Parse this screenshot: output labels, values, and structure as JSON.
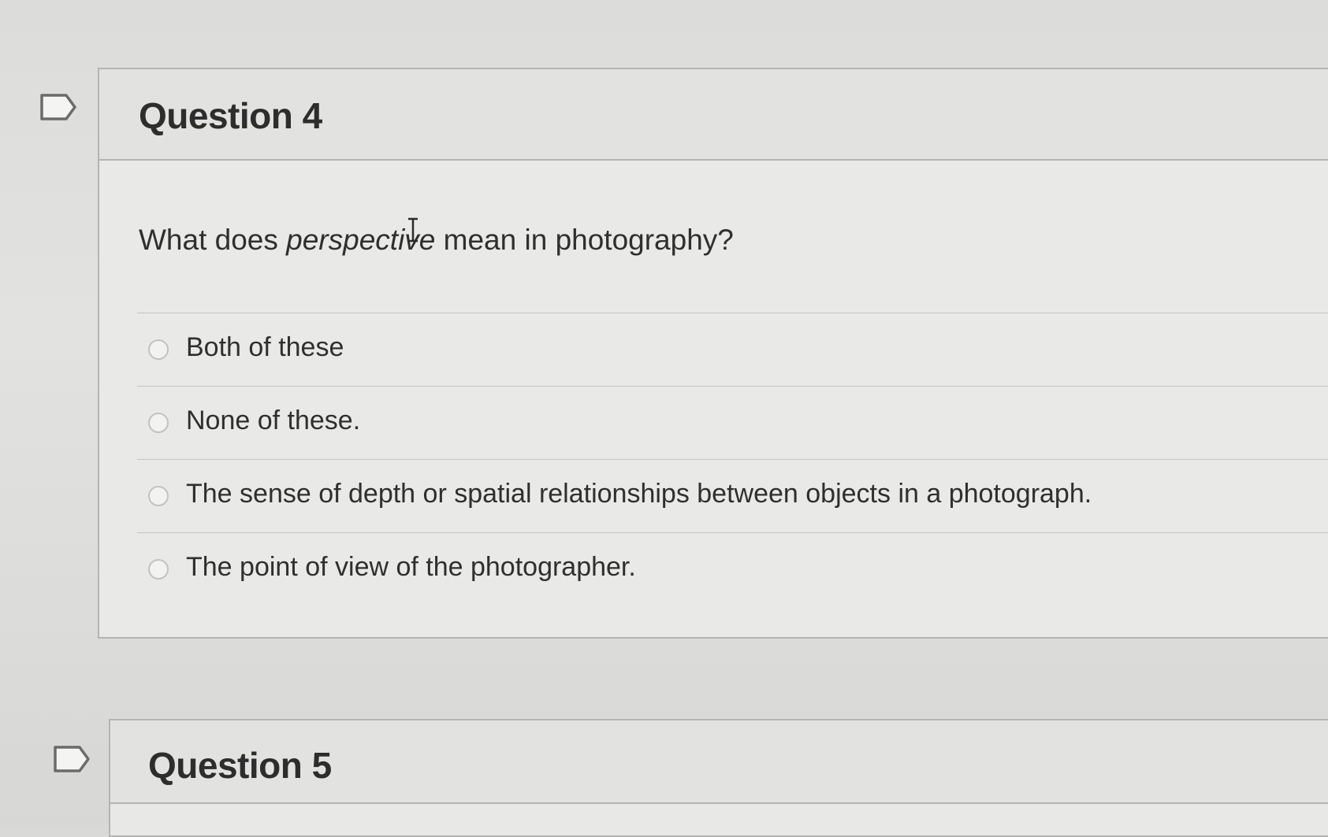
{
  "questions": [
    {
      "title": "Question 4",
      "prompt_before": "What does ",
      "prompt_emphasis": "perspective",
      "prompt_after": " mean in photography?",
      "answers": [
        {
          "label": "Both of these"
        },
        {
          "label": "None of these."
        },
        {
          "label": "The sense of depth or spatial relationships between objects in a photograph."
        },
        {
          "label": "The point of view of the photographer."
        }
      ]
    },
    {
      "title": "Question 5"
    }
  ],
  "icons": {
    "flag": "flag-outline-icon",
    "cursor": "text-cursor-icon",
    "radio": "radio-unselected-icon"
  },
  "colors": {
    "background": "#d9d9d7",
    "card": "#e8e8e6",
    "border": "#b4b4b2",
    "text": "#2f2f2f"
  }
}
